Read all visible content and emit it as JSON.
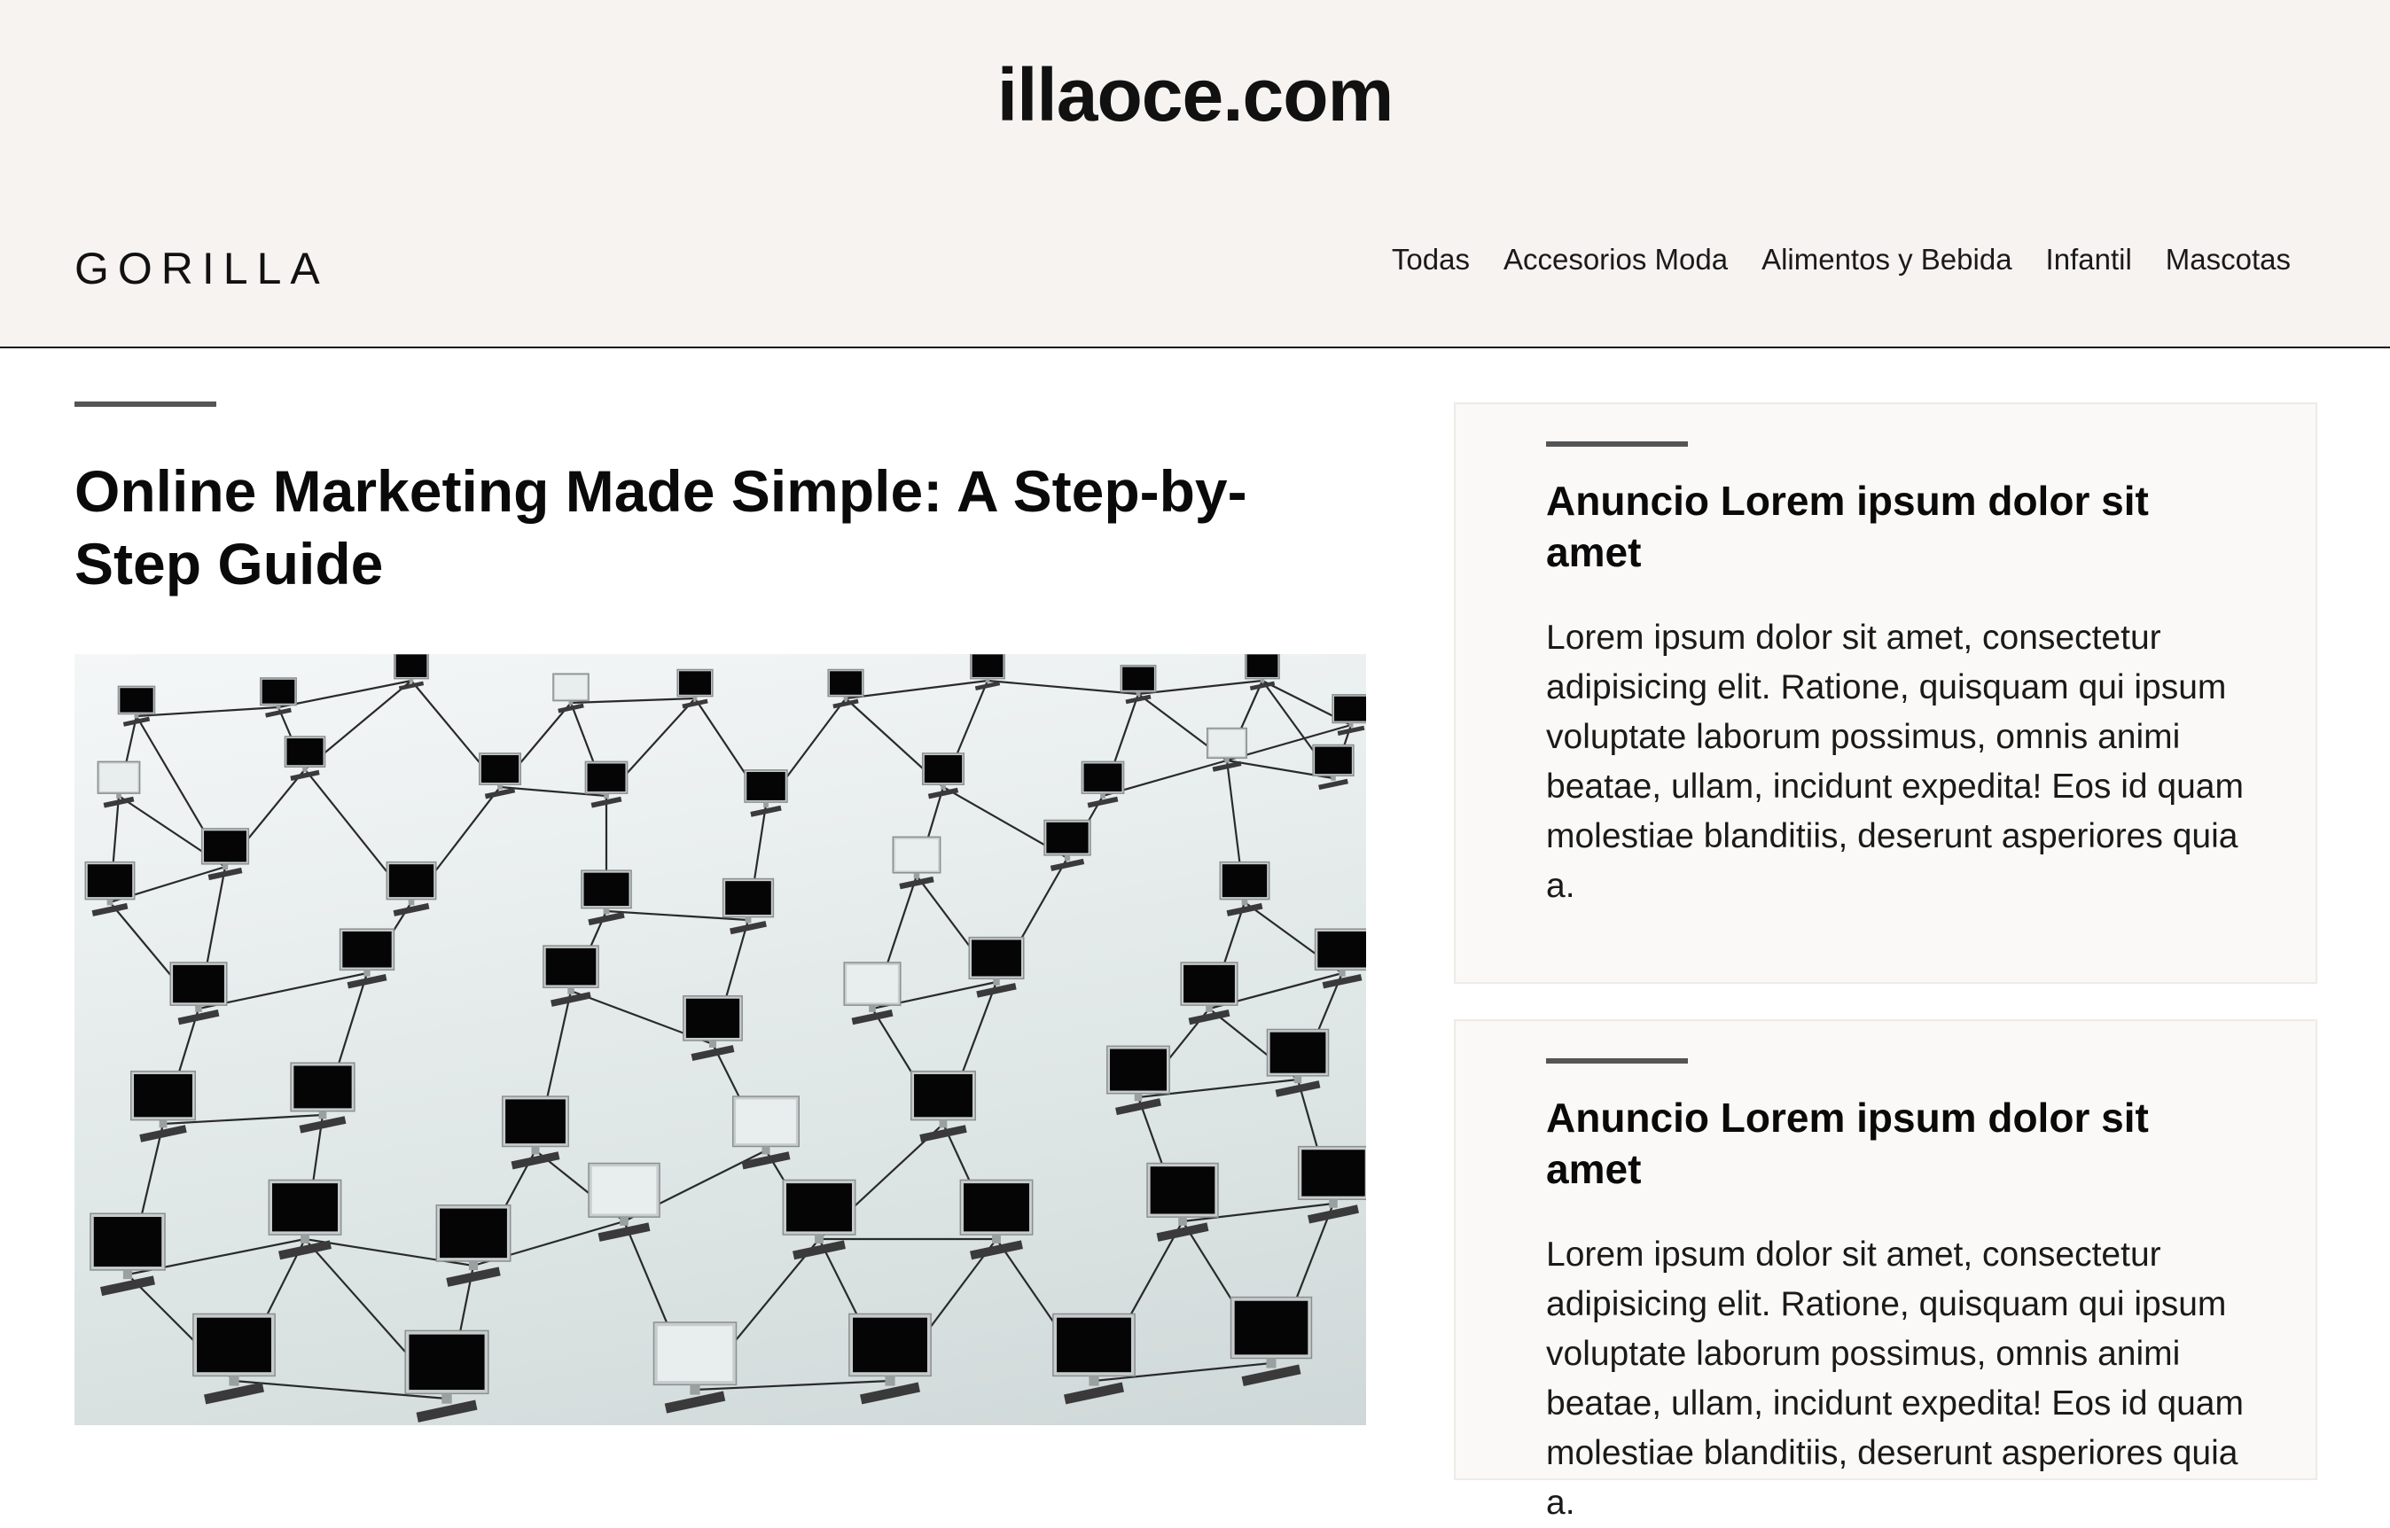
{
  "site": {
    "domain": "illaoce.com",
    "brand": "GORILLA"
  },
  "nav": {
    "items": [
      {
        "label": "Todas"
      },
      {
        "label": "Accesorios Moda"
      },
      {
        "label": "Alimentos y Bebida"
      },
      {
        "label": "Infantil"
      },
      {
        "label": "Mascotas"
      }
    ]
  },
  "article": {
    "title": "Online Marketing Made Simple: A Step-by-Step Guide",
    "image": "network-of-computers-image"
  },
  "sidebar": {
    "ads": [
      {
        "title": "Anuncio Lorem ipsum dolor sit amet",
        "text": "Lorem ipsum dolor sit amet, consectetur adipisicing elit. Ratione, quisquam qui ipsum voluptate laborum possimus, omnis animi beatae, ullam, incidunt expedita! Eos id quam molestiae blanditiis, deserunt asperiores quia a."
      },
      {
        "title": "Anuncio Lorem ipsum dolor sit amet",
        "text": "Lorem ipsum dolor sit amet, consectetur adipisicing elit. Ratione, quisquam qui ipsum voluptate laborum possimus, omnis animi beatae, ullam, incidunt expedita! Eos id quam molestiae blanditiis, deserunt asperiores quia a."
      }
    ]
  }
}
